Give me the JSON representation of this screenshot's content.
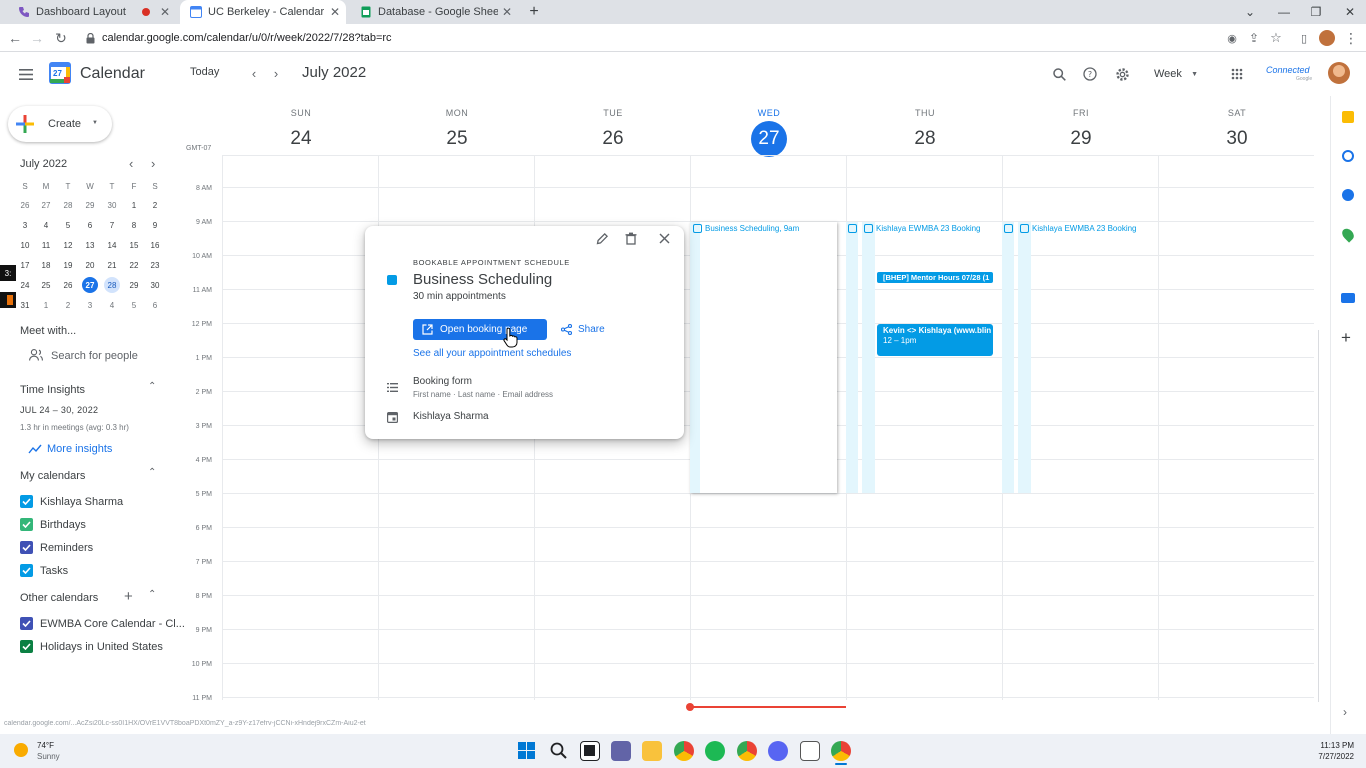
{
  "browser": {
    "tabs": [
      {
        "title": "Dashboard Layout"
      },
      {
        "title": "UC Berkeley - Calendar - Week :"
      },
      {
        "title": "Database - Google Sheets"
      }
    ],
    "url": "calendar.google.com/calendar/u/0/r/week/2022/7/28?tab=rc",
    "status_url": "calendar.google.com/...AcZsi20Lc-ss0I1HX/OVrE1VVT8boaPDXt0mZY_a-z9Y-z17efrv-jCCNi-xHndej9rxCZm-Aiu2-et"
  },
  "header": {
    "app_name": "Calendar",
    "logo_day": "27",
    "today_label": "Today",
    "period_title": "July 2022",
    "view_label": "Week",
    "brand_text": "Connected",
    "brand_sub": "Google"
  },
  "sidebar": {
    "create_label": "Create",
    "mini_cal": {
      "title": "July 2022",
      "weekdays": [
        "S",
        "M",
        "T",
        "W",
        "T",
        "F",
        "S"
      ],
      "weeks": [
        [
          "26",
          "27",
          "28",
          "29",
          "30",
          "1",
          "2"
        ],
        [
          "3",
          "4",
          "5",
          "6",
          "7",
          "8",
          "9"
        ],
        [
          "10",
          "11",
          "12",
          "13",
          "14",
          "15",
          "16"
        ],
        [
          "17",
          "18",
          "19",
          "20",
          "21",
          "22",
          "23"
        ],
        [
          "24",
          "25",
          "26",
          "27",
          "28",
          "29",
          "30"
        ],
        [
          "31",
          "1",
          "2",
          "3",
          "4",
          "5",
          "6"
        ]
      ]
    },
    "meet_with": "Meet with...",
    "search_people": "Search for people",
    "time_insights": {
      "heading": "Time Insights",
      "range": "JUL 24 – 30, 2022",
      "summary": "1.3 hr in meetings (avg: 0.3 hr)",
      "more": "More insights"
    },
    "my_calendars": {
      "heading": "My calendars",
      "items": [
        {
          "label": "Kishlaya Sharma",
          "color": "#039be5"
        },
        {
          "label": "Birthdays",
          "color": "#33b679"
        },
        {
          "label": "Reminders",
          "color": "#3f51b5"
        },
        {
          "label": "Tasks",
          "color": "#039be5"
        }
      ]
    },
    "other_calendars": {
      "heading": "Other calendars",
      "items": [
        {
          "label": "EWMBA Core Calendar - Cl...",
          "color": "#3f51b5"
        },
        {
          "label": "Holidays in United States",
          "color": "#0b8043"
        }
      ]
    }
  },
  "week": {
    "timezone": "GMT-07",
    "days": [
      {
        "name": "SUN",
        "num": "24"
      },
      {
        "name": "MON",
        "num": "25"
      },
      {
        "name": "TUE",
        "num": "26"
      },
      {
        "name": "WED",
        "num": "27"
      },
      {
        "name": "THU",
        "num": "28"
      },
      {
        "name": "FRI",
        "num": "29"
      },
      {
        "name": "SAT",
        "num": "30"
      }
    ],
    "hours": [
      "8 AM",
      "9 AM",
      "10 AM",
      "11 AM",
      "12 PM",
      "1 PM",
      "2 PM",
      "3 PM",
      "4 PM",
      "5 PM",
      "6 PM",
      "7 PM",
      "8 PM",
      "9 PM",
      "10 PM",
      "11 PM"
    ]
  },
  "events": {
    "wed_title": "Business Scheduling",
    "wed_time": ", 9am",
    "thu_booking": "Kishlaya EWMBA 23 Booking",
    "fri_booking": "Kishlaya EWMBA 23 Booking",
    "mentor": "[BHEP] Mentor Hours 07/28 (1",
    "kevin_title": "Kevin <> Kishlaya (www.blin",
    "kevin_time": "12 – 1pm"
  },
  "popup": {
    "kicker": "BOOKABLE APPOINTMENT SCHEDULE",
    "title": "Business Scheduling",
    "subtitle": "30 min appointments",
    "open_booking": "Open booking page",
    "share": "Share",
    "see_all": "See all your appointment schedules",
    "booking_form": "Booking form",
    "booking_fields": "First name · Last name · Email address",
    "owner": "Kishlaya Sharma",
    "color": "#039be5"
  },
  "taskbar": {
    "temp": "74°F",
    "weather": "Sunny",
    "time": "11:13 PM",
    "date": "7/27/2022"
  }
}
